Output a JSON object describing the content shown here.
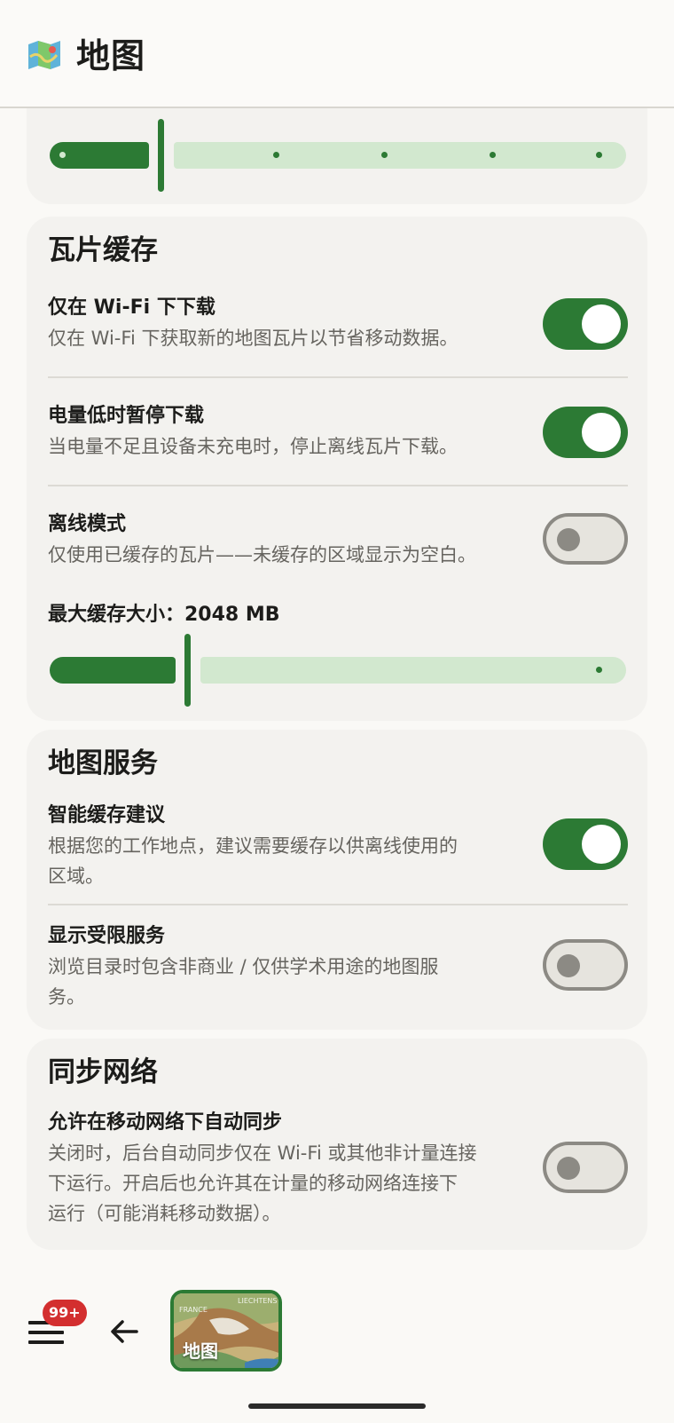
{
  "app": {
    "title": "地图"
  },
  "sections": {
    "top_slider": {
      "value_fraction": 0.2,
      "stops": 6
    },
    "tile_cache": {
      "title": "瓦片缓存",
      "wifi_only": {
        "title": "仅在 Wi-Fi 下下载",
        "desc": "仅在 Wi-Fi 下获取新的地图瓦片以节省移动数据。",
        "on": true
      },
      "pause_low_battery": {
        "title": "电量低时暂停下载",
        "desc": "当电量不足且设备未充电时，停止离线瓦片下载。",
        "on": true
      },
      "offline_mode": {
        "title": "离线模式",
        "desc": "仅使用已缓存的瓦片——未缓存的区域显示为空白。",
        "on": false
      },
      "max_cache": {
        "label": "最大缓存大小：2048 MB",
        "value_fraction": 0.24
      }
    },
    "map_services": {
      "title": "地图服务",
      "smart_cache": {
        "title": "智能缓存建议",
        "desc_line1": "根据您的工作地点，建议需要缓存以供离线使用的",
        "desc_line2": "区域。",
        "on": true
      },
      "restricted": {
        "title": "显示受限服务",
        "desc_line1": "浏览目录时包含非商业 / 仅供学术用途的地图服",
        "desc_line2": "务。",
        "on": false
      }
    },
    "sync_network": {
      "title": "同步网络",
      "mobile_sync": {
        "title": "允许在移动网络下自动同步",
        "desc_line1": "关闭时，后台自动同步仅在 Wi-Fi 或其他非计量连接",
        "desc_line2": "下运行。开启后也允许其在计量的移动网络连接下",
        "desc_line3": "运行（可能消耗移动数据）。",
        "on": false
      }
    }
  },
  "bottom_bar": {
    "badge": "99+",
    "thumbnail_label": "地图",
    "thumbnail_small_1": "FRANCE",
    "thumbnail_small_2": "LIECHTENS"
  },
  "colors": {
    "accent": "#2c7a34",
    "track_inactive": "#d2e8cf",
    "badge": "#d32f2f",
    "card_bg": "#f3f2ef"
  }
}
